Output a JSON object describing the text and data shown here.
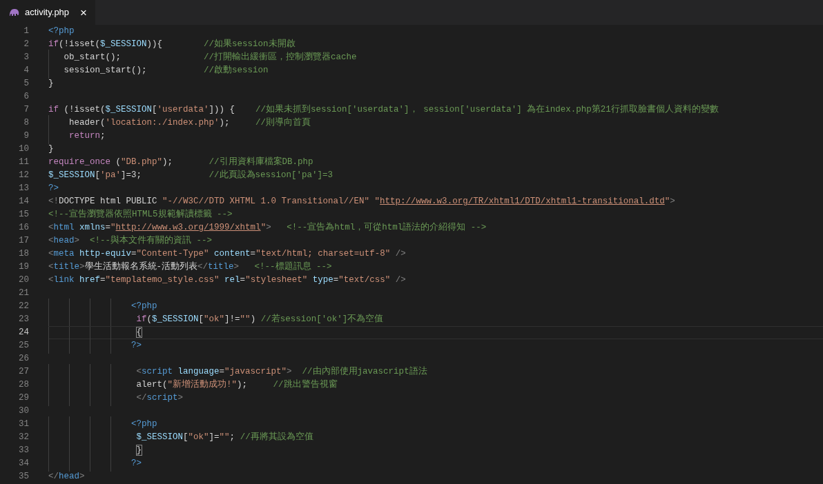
{
  "tabs": [
    {
      "label": "activity.php",
      "selected": true,
      "close": "×"
    }
  ],
  "lines": [
    {
      "number": "1",
      "selected": false,
      "tokens": [
        {
          "kind": "tag",
          "text": "<?php"
        }
      ]
    },
    {
      "number": "2",
      "selected": false,
      "tokens": [
        {
          "kind": "kw",
          "text": "if"
        },
        {
          "kind": "p",
          "text": "(!isset("
        },
        {
          "kind": "var",
          "text": "$_SESSION"
        },
        {
          "kind": "p",
          "text": ")){"
        },
        {
          "kind": "cmt",
          "text": "        //如果session未開啟"
        }
      ]
    },
    {
      "number": "3",
      "selected": false,
      "tokens": [
        {
          "kind": "p",
          "text": "   ob_start();"
        },
        {
          "kind": "cmt",
          "text": "                //打開輸出緩衝區，控制瀏覽器cache"
        }
      ]
    },
    {
      "number": "4",
      "selected": false,
      "tokens": [
        {
          "kind": "p",
          "text": "   session_start();"
        },
        {
          "kind": "cmt",
          "text": "           //啟動session"
        }
      ]
    },
    {
      "number": "5",
      "selected": false,
      "tokens": [
        {
          "kind": "p",
          "text": "}"
        }
      ]
    },
    {
      "number": "6",
      "selected": false
    },
    {
      "number": "7",
      "selected": false,
      "tokens": [
        {
          "kind": "kw",
          "text": "if"
        },
        {
          "kind": "p",
          "text": " (!isset("
        },
        {
          "kind": "var",
          "text": "$_SESSION"
        },
        {
          "kind": "p",
          "text": "["
        },
        {
          "kind": "str",
          "text": "'userdata'"
        },
        {
          "kind": "p",
          "text": "])) {"
        },
        {
          "kind": "cmt",
          "text": "    //如果未抓到session['userdata']， session['userdata'] 為在index.php第21行抓取臉書個人資料的變數"
        }
      ]
    },
    {
      "number": "8",
      "selected": false,
      "tokens": [
        {
          "kind": "p",
          "text": "    header("
        },
        {
          "kind": "str",
          "text": "'location:./index.php'"
        },
        {
          "kind": "p",
          "text": ");"
        },
        {
          "kind": "cmt",
          "text": "     //則導向首頁"
        }
      ]
    },
    {
      "number": "9",
      "selected": false,
      "tokens": [
        {
          "kind": "kw",
          "text": "    return"
        },
        {
          "kind": "p",
          "text": ";"
        }
      ]
    },
    {
      "number": "10",
      "selected": false,
      "tokens": [
        {
          "kind": "p",
          "text": "}"
        }
      ]
    },
    {
      "number": "11",
      "selected": false,
      "tokens": [
        {
          "kind": "kw",
          "text": "require_once"
        },
        {
          "kind": "p",
          "text": " ("
        },
        {
          "kind": "str",
          "text": "\"DB.php\""
        },
        {
          "kind": "p",
          "text": ");"
        },
        {
          "kind": "cmt",
          "text": "       //引用資料庫檔案DB.php"
        }
      ]
    },
    {
      "number": "12",
      "selected": false,
      "tokens": [
        {
          "kind": "var",
          "text": "$_SESSION"
        },
        {
          "kind": "p",
          "text": "["
        },
        {
          "kind": "str",
          "text": "'pa'"
        },
        {
          "kind": "p",
          "text": "]=3;"
        },
        {
          "kind": "cmt",
          "text": "             //此頁設為session['pa']=3"
        }
      ]
    },
    {
      "number": "13",
      "selected": false,
      "tokens": [
        {
          "kind": "tag",
          "text": "?>"
        }
      ]
    },
    {
      "number": "14",
      "selected": false,
      "tokens": [
        {
          "kind": "punc",
          "text": "<!"
        },
        {
          "kind": "p",
          "text": "DOCTYPE html PUBLIC "
        },
        {
          "kind": "str",
          "text": "\"-//W3C//DTD XHTML 1.0 Transitional//EN\" \""
        },
        {
          "kind": "link",
          "text": "http://www.w3.org/TR/xhtml1/DTD/xhtml1-transitional.dtd"
        },
        {
          "kind": "str",
          "text": "\""
        },
        {
          "kind": "punc",
          "text": ">"
        }
      ]
    },
    {
      "number": "15",
      "selected": false,
      "tokens": [
        {
          "kind": "cmt",
          "text": "<!--宣告瀏覽器依照HTML5規範解讀標籤 -->"
        }
      ]
    },
    {
      "number": "16",
      "selected": false,
      "tokens": [
        {
          "kind": "punc",
          "text": "<"
        },
        {
          "kind": "tag",
          "text": "html"
        },
        {
          "kind": "attr",
          "text": " xmlns"
        },
        {
          "kind": "p",
          "text": "="
        },
        {
          "kind": "str",
          "text": "\""
        },
        {
          "kind": "link",
          "text": "http://www.w3.org/1999/xhtml"
        },
        {
          "kind": "str",
          "text": "\""
        },
        {
          "kind": "punc",
          "text": ">"
        },
        {
          "kind": "cmt",
          "text": "   <!--宣告為html，可從html語法的介紹得知 -->"
        }
      ]
    },
    {
      "number": "17",
      "selected": false,
      "tokens": [
        {
          "kind": "punc",
          "text": "<"
        },
        {
          "kind": "tag",
          "text": "head"
        },
        {
          "kind": "punc",
          "text": ">"
        },
        {
          "kind": "cmt",
          "text": "  <!--與本文件有關的資訊 -->"
        }
      ]
    },
    {
      "number": "18",
      "selected": false,
      "tokens": [
        {
          "kind": "punc",
          "text": "<"
        },
        {
          "kind": "tag",
          "text": "meta"
        },
        {
          "kind": "attr",
          "text": " http-equiv"
        },
        {
          "kind": "p",
          "text": "="
        },
        {
          "kind": "str",
          "text": "\"Content-Type\""
        },
        {
          "kind": "attr",
          "text": " content"
        },
        {
          "kind": "p",
          "text": "="
        },
        {
          "kind": "str",
          "text": "\"text/html; charset=utf-8\""
        },
        {
          "kind": "punc",
          "text": " />"
        }
      ]
    },
    {
      "number": "19",
      "selected": false,
      "tokens": [
        {
          "kind": "punc",
          "text": "<"
        },
        {
          "kind": "tag",
          "text": "title"
        },
        {
          "kind": "punc",
          "text": ">"
        },
        {
          "kind": "p",
          "text": "學生活動報名系統-活動列表"
        },
        {
          "kind": "punc",
          "text": "</"
        },
        {
          "kind": "tag",
          "text": "title"
        },
        {
          "kind": "punc",
          "text": ">"
        },
        {
          "kind": "cmt",
          "text": "   <!--標題訊息 -->"
        }
      ]
    },
    {
      "number": "20",
      "selected": false,
      "tokens": [
        {
          "kind": "punc",
          "text": "<"
        },
        {
          "kind": "tag",
          "text": "link"
        },
        {
          "kind": "attr",
          "text": " href"
        },
        {
          "kind": "p",
          "text": "="
        },
        {
          "kind": "str",
          "text": "\"templatemo_style.css\""
        },
        {
          "kind": "attr",
          "text": " rel"
        },
        {
          "kind": "p",
          "text": "="
        },
        {
          "kind": "str",
          "text": "\"stylesheet\""
        },
        {
          "kind": "attr",
          "text": " type"
        },
        {
          "kind": "p",
          "text": "="
        },
        {
          "kind": "str",
          "text": "\"text/css\""
        },
        {
          "kind": "punc",
          "text": " />"
        }
      ]
    },
    {
      "number": "21",
      "selected": false
    },
    {
      "number": "22",
      "selected": false,
      "tokens": [
        {
          "kind": "tag",
          "text": "                <?php"
        }
      ]
    },
    {
      "number": "23",
      "selected": false,
      "tokens": [
        {
          "kind": "kw",
          "text": "                 if"
        },
        {
          "kind": "p",
          "text": "("
        },
        {
          "kind": "var",
          "text": "$_SESSION"
        },
        {
          "kind": "p",
          "text": "["
        },
        {
          "kind": "str",
          "text": "\"ok\""
        },
        {
          "kind": "p",
          "text": "]!="
        },
        {
          "kind": "str",
          "text": "\"\""
        },
        {
          "kind": "p",
          "text": ")"
        },
        {
          "kind": "cmt",
          "text": " //若session['ok']不為空值"
        }
      ]
    },
    {
      "number": "24",
      "selected": true,
      "tokens": [
        {
          "kind": "match",
          "text": "                 {"
        }
      ]
    },
    {
      "number": "25",
      "selected": false,
      "tokens": [
        {
          "kind": "tag",
          "text": "                ?>"
        }
      ]
    },
    {
      "number": "26",
      "selected": false
    },
    {
      "number": "27",
      "selected": false,
      "tokens": [
        {
          "kind": "punc",
          "text": "                 <"
        },
        {
          "kind": "tag",
          "text": "script"
        },
        {
          "kind": "attr",
          "text": " language"
        },
        {
          "kind": "p",
          "text": "="
        },
        {
          "kind": "str",
          "text": "\"javascript\""
        },
        {
          "kind": "punc",
          "text": ">"
        },
        {
          "kind": "cmt",
          "text": "  //由內部使用javascript語法"
        }
      ]
    },
    {
      "number": "28",
      "selected": false,
      "tokens": [
        {
          "kind": "p",
          "text": "                 alert("
        },
        {
          "kind": "str",
          "text": "\"新增活動成功!\""
        },
        {
          "kind": "p",
          "text": ");"
        },
        {
          "kind": "cmt",
          "text": "     //跳出警告視窗"
        }
      ]
    },
    {
      "number": "29",
      "selected": false,
      "tokens": [
        {
          "kind": "punc",
          "text": "                 </"
        },
        {
          "kind": "tag",
          "text": "script"
        },
        {
          "kind": "punc",
          "text": ">"
        }
      ]
    },
    {
      "number": "30",
      "selected": false
    },
    {
      "number": "31",
      "selected": false,
      "tokens": [
        {
          "kind": "tag",
          "text": "                <?php"
        }
      ]
    },
    {
      "number": "32",
      "selected": false,
      "tokens": [
        {
          "kind": "var",
          "text": "                 $_SESSION"
        },
        {
          "kind": "p",
          "text": "["
        },
        {
          "kind": "str",
          "text": "\"ok\""
        },
        {
          "kind": "p",
          "text": "]="
        },
        {
          "kind": "str",
          "text": "\"\""
        },
        {
          "kind": "p",
          "text": ";"
        },
        {
          "kind": "cmt",
          "text": " //再將其設為空值"
        }
      ]
    },
    {
      "number": "33",
      "selected": false,
      "tokens": [
        {
          "kind": "match",
          "text": "                 }"
        }
      ]
    },
    {
      "number": "34",
      "selected": false,
      "tokens": [
        {
          "kind": "tag",
          "text": "                ?>"
        }
      ]
    },
    {
      "number": "35",
      "selected": false,
      "tokens": [
        {
          "kind": "punc",
          "text": "</"
        },
        {
          "kind": "tag",
          "text": "head"
        },
        {
          "kind": "punc",
          "text": ">"
        }
      ]
    }
  ]
}
